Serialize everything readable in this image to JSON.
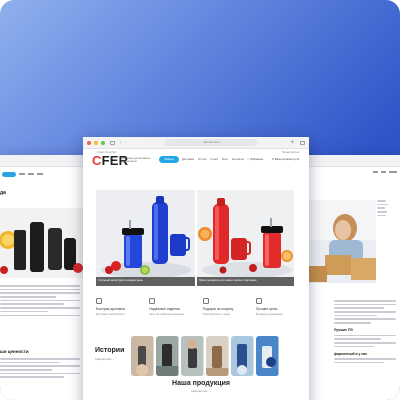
{
  "left_window": {
    "heading": "да",
    "values_heading": "ши ценности"
  },
  "center_window": {
    "url": "cfer-tuv.com",
    "top_left_text": "г. Санкт-Петербург",
    "top_right_text": "Личный кабинет",
    "logo_prefix": "C",
    "logo_rest": "FER",
    "logo_tagline": "Продукция для активного образа жизни",
    "products_button": "Товары",
    "menu": [
      "Доставка",
      "Оптом",
      "О нас",
      "Блог",
      "Контакты"
    ],
    "favorites": "Избранное",
    "cart": "Ваша корзина пуста",
    "banner_left_caption": "Стильный аксессуар на каждый день",
    "banner_right_caption": "Яркие расцветки для самых смелых и активных",
    "features": [
      {
        "icon": "truck-icon",
        "title": "Быстрая доставка",
        "sub": "Доставим по всей России"
      },
      {
        "icon": "shield-icon",
        "title": "Надёжные изделия",
        "sub": "Качество проверено временем"
      },
      {
        "icon": "gift-icon",
        "title": "Подарок за покупку",
        "sub": "Приятный бонус к заказу"
      },
      {
        "icon": "tag-icon",
        "title": "Лучшие цены",
        "sub": "Выгодные предложения"
      }
    ],
    "stories_title": "Истории",
    "stories_link": "Смотреть все →",
    "products_title": "Наша продукция",
    "products_sub": "Смотреть все →"
  },
  "right_window": {
    "bold_line_1": "Лучшие ПЭ",
    "bold_line_2": "фирменный в у нас"
  },
  "colors": {
    "accent": "#22a8e8",
    "brand_red": "#e03a3a",
    "background_gradient_start": "#8fb0ee",
    "background_gradient_end": "#1f3fae"
  }
}
